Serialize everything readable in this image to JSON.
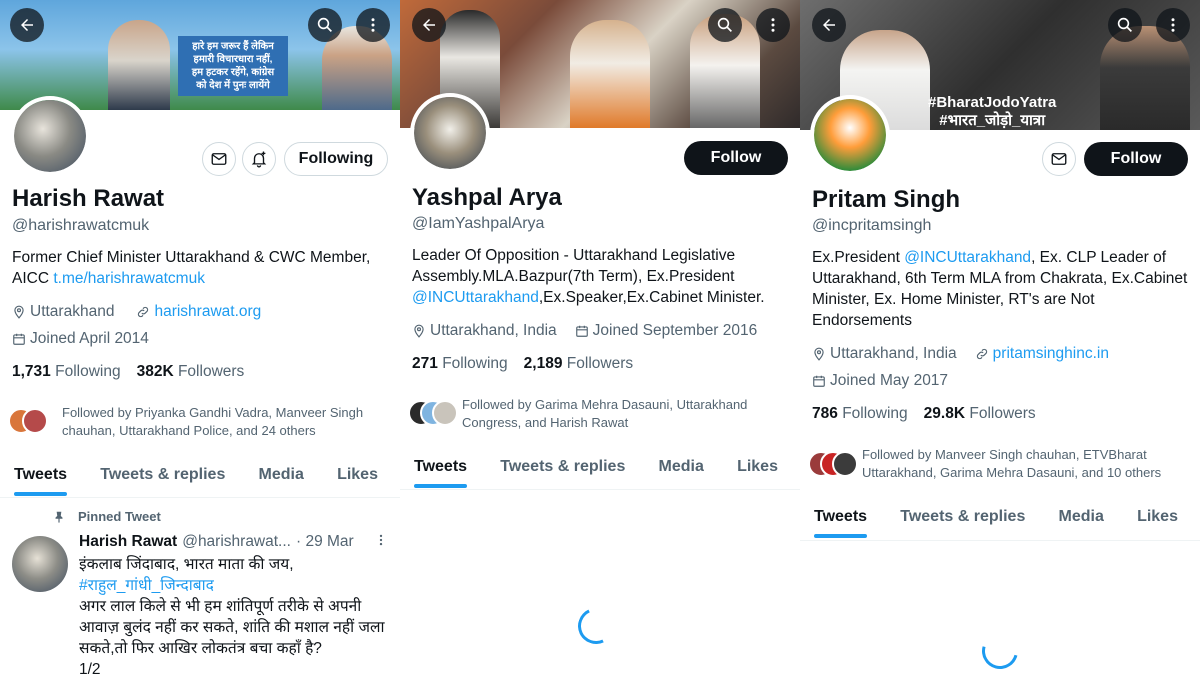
{
  "panel1": {
    "banner_text": [
      "हारे हम जरूर हैं लेकिन",
      "हमारी विचारधारा नहीं,",
      "हम हटकर रहेंगे, कांग्रेस",
      "को देश में पुनः लायेंगे"
    ],
    "following_label": "Following",
    "name": "Harish Rawat",
    "handle": "@harishrawatcmuk",
    "bio_text": "Former Chief Minister Uttarakhand &  CWC Member, AICC ",
    "bio_link": "t.me/harishrawatcmuk",
    "location": "Uttarakhand",
    "website": "harishrawat.org",
    "joined": "Joined April 2014",
    "following_count": "1,731",
    "following_word": "Following",
    "followers_count": "382K",
    "followers_word": "Followers",
    "followed_by": "Followed by Priyanka Gandhi Vadra, Manveer Singh chauhan, Uttarakhand Police, and 24 others",
    "tabs": [
      "Tweets",
      "Tweets & replies",
      "Media",
      "Likes"
    ],
    "pinned_label": "Pinned Tweet",
    "tweet_name": "Harish Rawat",
    "tweet_handle": "@harishrawat...",
    "tweet_date": "· 29 Mar",
    "tweet_line1": "इंकलाब जिंदाबाद, भारत माता की जय,",
    "tweet_hashtag": "#राहुल_गांधी_जिन्दाबाद",
    "tweet_body": "अगर लाल किले से भी हम शांतिपूर्ण तरीके से अपनी आवाज़ बुलंद नहीं कर सकते, शांति की मशाल नहीं जला सकते,तो फिर आखिर लोकतंत्र बचा कहाँ है?",
    "tweet_count": "1/2"
  },
  "panel2": {
    "follow_label": "Follow",
    "name": "Yashpal Arya",
    "handle": "@IamYashpalArya",
    "bio_part1": "Leader Of Opposition - Uttarakhand Legislative Assembly.MLA.Bazpur(7th Term), Ex.President ",
    "bio_link": "@INCUttarakhand",
    "bio_part2": ",Ex.Speaker,Ex.Cabinet Minister.",
    "location": "Uttarakhand, India",
    "joined": "Joined September 2016",
    "following_count": "271",
    "following_word": "Following",
    "followers_count": "2,189",
    "followers_word": "Followers",
    "followed_by": "Followed by Garima Mehra Dasauni, Uttarakhand Congress, and Harish Rawat",
    "tabs": [
      "Tweets",
      "Tweets & replies",
      "Media",
      "Likes"
    ]
  },
  "panel3": {
    "banner_text1": "#BharatJodoYatra",
    "banner_text2": "#भारत_जोड़ो_यात्रा",
    "follow_label": "Follow",
    "name": "Pritam Singh",
    "handle": "@incpritamsingh",
    "bio_part1": "Ex.President ",
    "bio_link": "@INCUttarakhand",
    "bio_part2": ", Ex. CLP Leader of Uttarakhand, 6th Term MLA from Chakrata, Ex.Cabinet Minister, Ex. Home Minister, RT's are Not Endorsements",
    "location": "Uttarakhand, India",
    "website": "pritamsinghinc.in",
    "joined": "Joined May 2017",
    "following_count": "786",
    "following_word": "Following",
    "followers_count": "29.8K",
    "followers_word": "Followers",
    "followed_by": "Followed by Manveer Singh chauhan, ETVBharat Uttarakhand, Garima Mehra Dasauni, and 10 others",
    "tabs": [
      "Tweets",
      "Tweets & replies",
      "Media",
      "Likes"
    ]
  },
  "colors": {
    "accent": "#1d9bf0",
    "text": "#0f1419",
    "muted": "#536471",
    "button_dark": "#0f1419"
  },
  "icons": [
    "back-arrow-icon",
    "search-icon",
    "more-vertical-icon",
    "mail-icon",
    "bell-plus-icon",
    "location-icon",
    "link-icon",
    "calendar-icon",
    "pin-icon",
    "loading-spinner"
  ]
}
